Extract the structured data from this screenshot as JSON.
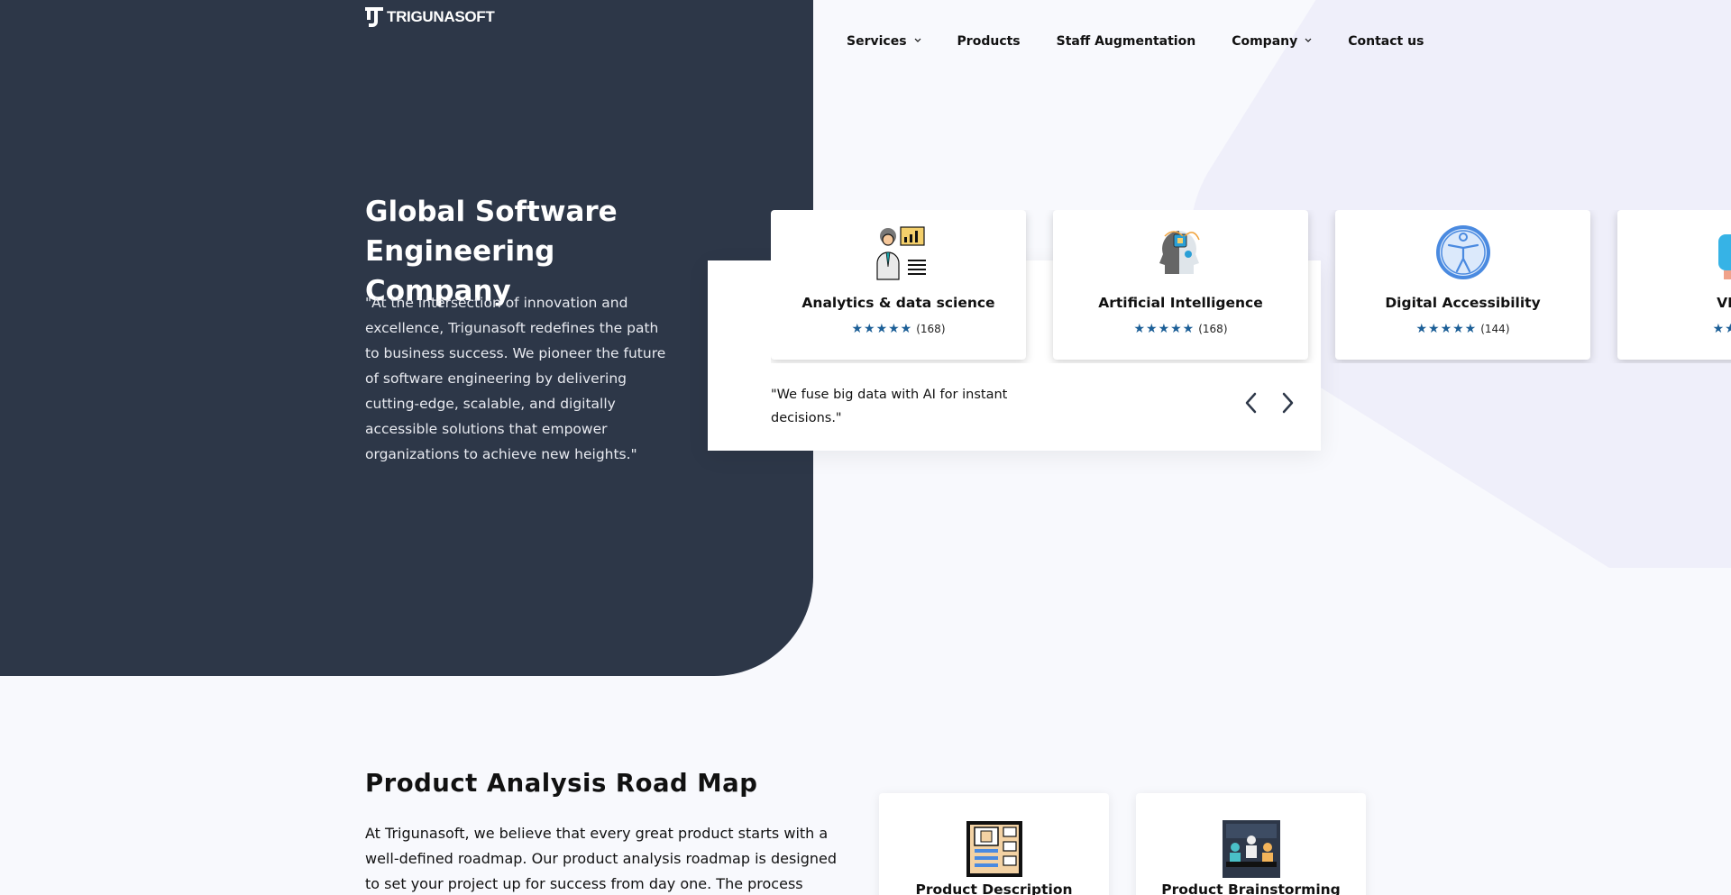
{
  "brand": {
    "name": "TRIGUNASOFT"
  },
  "nav": {
    "items": [
      {
        "label": "Services",
        "dropdown": true
      },
      {
        "label": "Products",
        "dropdown": false
      },
      {
        "label": "Staff Augmentation",
        "dropdown": false
      },
      {
        "label": "Company",
        "dropdown": true
      },
      {
        "label": "Contact us",
        "dropdown": false
      }
    ]
  },
  "hero": {
    "title": "Global Software Engineering Company",
    "text": "\"At the intersection of innovation and excellence, Trigunasoft redefines the path to business success. We pioneer the future of software engineering by delivering cutting-edge, scalable, and digitally accessible solutions that empower organizations to achieve new heights.\""
  },
  "carousel": {
    "cards": [
      {
        "title": "Analytics & data science",
        "rating_count": "(168)",
        "stars": 5,
        "icon": "analytics-icon"
      },
      {
        "title": "Artificial Intelligence",
        "rating_count": "(168)",
        "stars": 5,
        "icon": "ai-head-icon"
      },
      {
        "title": "Digital Accessibility",
        "rating_count": "(144)",
        "stars": 5,
        "icon": "accessibility-icon"
      },
      {
        "title": "VR Dev",
        "rating_count": "",
        "stars": 5,
        "icon": "vr-icon"
      }
    ],
    "quote": "\"We fuse big data with AI for instant decisions.\"",
    "prev_icon": "chevron-left-icon",
    "next_icon": "chevron-right-icon"
  },
  "roadmap": {
    "title": "Product Analysis Road Map",
    "text": "At Trigunasoft, we believe that every great product starts with a well-defined roadmap. Our product analysis roadmap is designed to set your project up for success from day one. The process",
    "cards": [
      {
        "title": "Product Description",
        "icon": "product-description-icon"
      },
      {
        "title": "Product Brainstorming",
        "icon": "brainstorming-icon"
      }
    ]
  },
  "colors": {
    "hero_dark": "#2d3748",
    "star": "#1c5f97",
    "page_bg": "#f8f9fd"
  }
}
